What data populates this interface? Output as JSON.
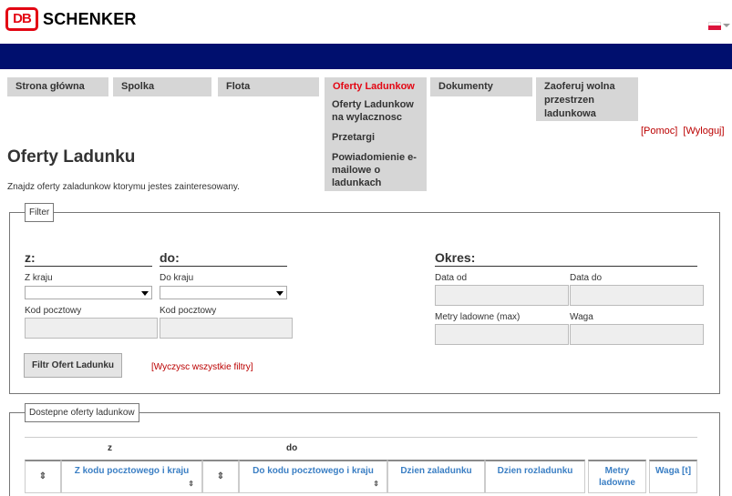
{
  "header": {
    "brand_db": "DB",
    "brand_name": "SCHENKER"
  },
  "nav": {
    "tabs": [
      {
        "label": "Strona główna"
      },
      {
        "label": "Spolka"
      },
      {
        "label": "Flota"
      },
      {
        "label": "Oferty Ladunkow"
      },
      {
        "label": "Dokumenty"
      },
      {
        "label": "Zaoferuj wolna przestrzen ladunkowa"
      }
    ],
    "submenu": [
      {
        "label": "Oferty Ladunkow na wylacznosc"
      },
      {
        "label": "Przetargi"
      },
      {
        "label": "Powiadomienie e-mailowe o ladunkach"
      }
    ]
  },
  "toplinks": {
    "help": "[Pomoc]",
    "logout": "[Wyloguj]"
  },
  "page": {
    "title": "Oferty Ladunku",
    "subtitle": "Znajdz oferty zaladunkow ktorymu jestes zainteresowany."
  },
  "filter": {
    "legend": "Filter",
    "from_label": "z:",
    "to_label": "do:",
    "period_label": "Okres:",
    "from_country": "Z kraju",
    "to_country": "Do kraju",
    "from_postcode": "Kod pocztowy",
    "to_postcode": "Kod pocztowy",
    "date_from": "Data od",
    "date_to": "Data do",
    "loading_meters": "Metry ladowne (max)",
    "weight": "Waga",
    "submit": "Filtr Ofert Ladunku",
    "clear": "[Wyczysc wszystkie filtry]"
  },
  "results": {
    "legend": "Dostepne oferty ladunkow",
    "group_from": "z",
    "group_to": "do",
    "sort_symbol": "⇕",
    "columns": [
      "Z kodu pocztowego i kraju",
      "Do kodu pocztowego i kraju",
      "Dzien zaladunku",
      "Dzien rozladunku",
      "Metry ladowne",
      "Waga [t]"
    ]
  },
  "colors": {
    "brand_red": "#e30613",
    "header_blue": "#000f6e",
    "link_blue": "#3b7fc4"
  }
}
